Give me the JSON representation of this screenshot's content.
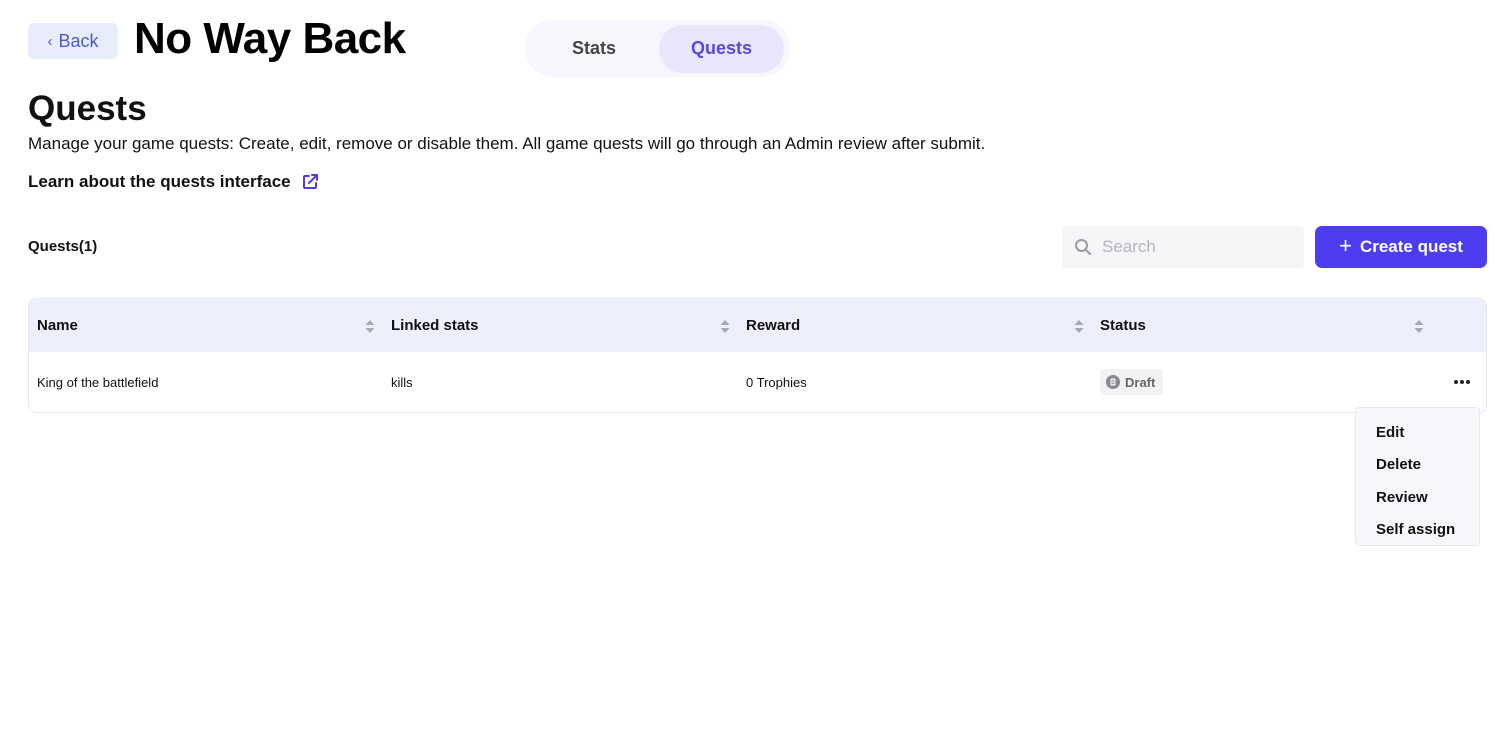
{
  "header": {
    "back_label": "Back",
    "game_title": "No Way Back",
    "tabs": [
      {
        "label": "Stats",
        "active": false
      },
      {
        "label": "Quests",
        "active": true
      }
    ]
  },
  "page": {
    "title": "Quests",
    "description": "Manage your game quests: Create, edit, remove or disable them. All game quests will go through an Admin review after submit.",
    "learn_link": "Learn about the quests interface"
  },
  "toolbar": {
    "count_label": "Quests(1)",
    "search_placeholder": "Search",
    "search_value": "",
    "create_label": "Create quest"
  },
  "table": {
    "columns": [
      "Name",
      "Linked stats",
      "Reward",
      "Status"
    ],
    "rows": [
      {
        "name": "King of the battlefield",
        "linked_stats": "kills",
        "reward": "0 Trophies",
        "status": "Draft"
      }
    ]
  },
  "row_menu": {
    "items": [
      "Edit",
      "Delete",
      "Review",
      "Self assign"
    ]
  },
  "colors": {
    "accent": "#4c3ef0",
    "tab_active_text": "#5b4ad9",
    "table_header_bg": "#eeeffd",
    "back_bg": "#e8ecfb"
  }
}
